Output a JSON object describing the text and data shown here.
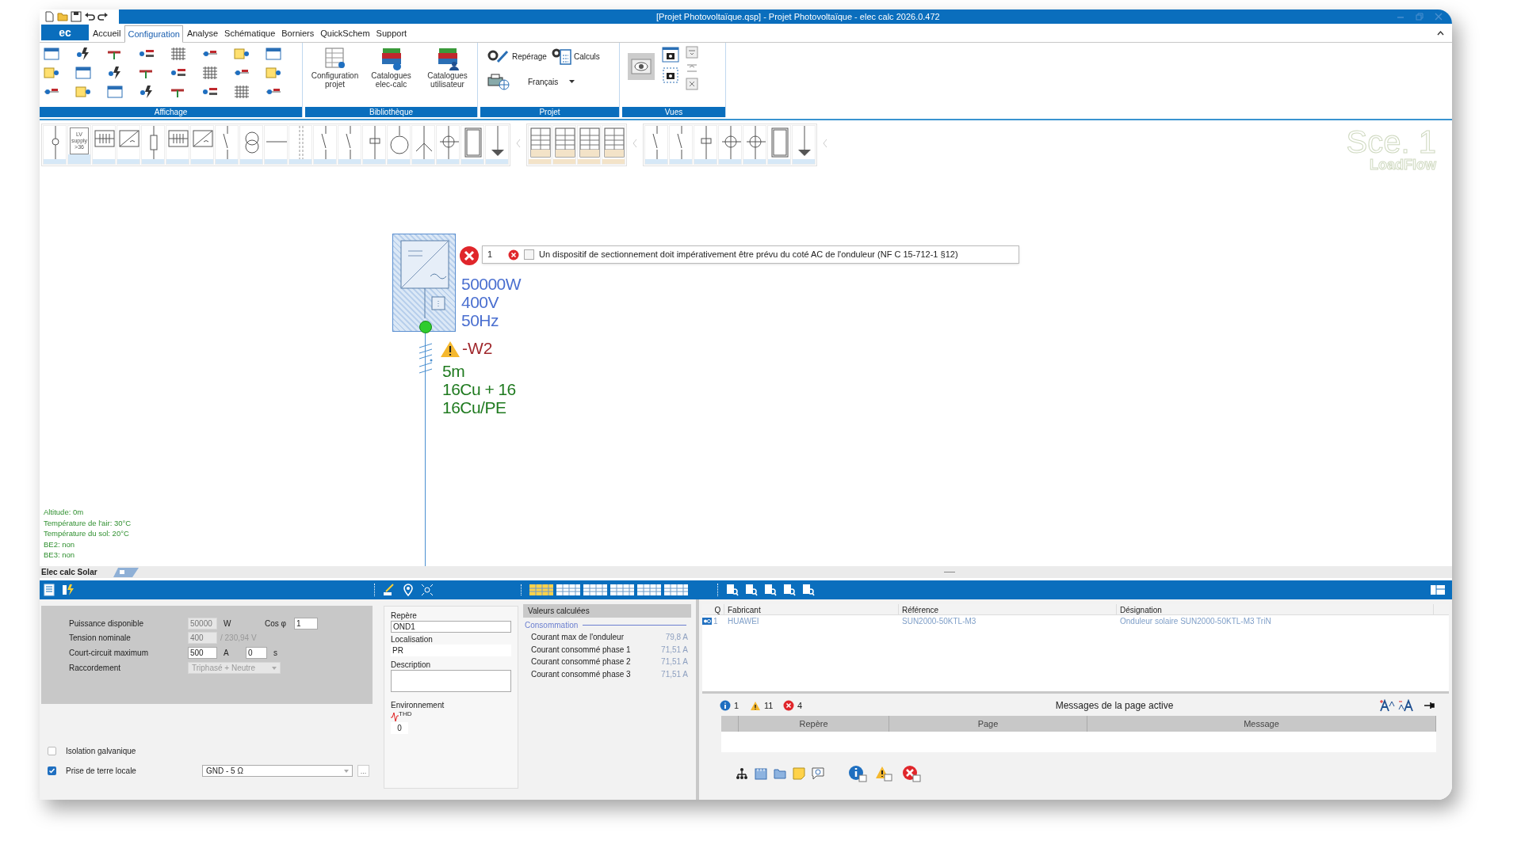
{
  "window": {
    "title": "[Projet Photovoltaïque.qsp] - Projet Photovoltaïque - elec calc 2026.0.472"
  },
  "app_button": "ec",
  "menu_tabs": [
    {
      "label": "Accueil",
      "selected": false
    },
    {
      "label": "Configuration",
      "selected": true
    },
    {
      "label": "Analyse",
      "selected": false
    },
    {
      "label": "Schématique",
      "selected": false
    },
    {
      "label": "Borniers",
      "selected": false
    },
    {
      "label": "QuickSchem",
      "selected": false
    },
    {
      "label": "Support",
      "selected": false
    }
  ],
  "ribbon": {
    "affichage": {
      "label": "Affichage"
    },
    "bibliotheque": {
      "label": "Bibliothèque",
      "buttons": [
        {
          "kind": "config",
          "label": "Configuration projet"
        },
        {
          "kind": "books",
          "label": "Catalogues elec-calc"
        },
        {
          "kind": "books_user",
          "label": "Catalogues utilisateur"
        }
      ]
    },
    "projet": {
      "label": "Projet",
      "repere": "Repérage",
      "calculs": "Calculs",
      "language": "Français"
    },
    "vues": {
      "label": "Vues"
    }
  },
  "symbol_toolbar": {
    "supply_label": "LV supply >36"
  },
  "scenario": {
    "name": "Sce. 1",
    "mode": "LoadFlow"
  },
  "diagram": {
    "connected": true,
    "error": {
      "count": "1",
      "message": "Un dispositif de sectionnement doit impérativement être prévu du coté AC de l'onduleur (NF C 15-712-1 §12)"
    },
    "ratings": [
      "50000W",
      "400V",
      "50Hz"
    ],
    "cable": {
      "name": "-W2",
      "warning": true,
      "lines": [
        "5m",
        "16Cu + 16",
        "16Cu/PE"
      ]
    }
  },
  "environment": [
    "Altitude: 0m",
    "Température de l'air: 30°C",
    "Température du sol: 20°C",
    "BE2: non",
    "BE3: non"
  ],
  "bottom_tab": "Elec calc Solar",
  "source": {
    "power": {
      "label": "Puissance disponible",
      "value": "50000",
      "unit": "W",
      "disabled": true
    },
    "cos_phi": {
      "label": "Cos φ",
      "value": "1",
      "disabled": false
    },
    "voltage": {
      "label": "Tension nominale",
      "value": "400",
      "note": "/ 230,94 V",
      "disabled": true
    },
    "short_circuit": {
      "label": "Court-circuit maximum",
      "value": "500",
      "unit": "A",
      "time_value": "0",
      "time_unit": "s",
      "disabled": false
    },
    "connection": {
      "label": "Raccordement",
      "value": "Triphasé + Neutre",
      "disabled": true
    },
    "options": [
      {
        "label": "Isolation galvanique",
        "checked": false
      },
      {
        "label": "Prise de terre locale",
        "checked": true,
        "select": "GND - 5 Ω",
        "browse": "..."
      }
    ]
  },
  "identity": {
    "repere_label": "Repère",
    "repere": "OND1",
    "localisation_label": "Localisation",
    "localisation": "PR",
    "description_label": "Description",
    "environment_label": "Environnement",
    "thd_label": "THD",
    "thd_value": "0"
  },
  "computed": {
    "title": "Valeurs calculées",
    "section": "Consommation",
    "rows": [
      {
        "label": "Courant max de l'onduleur",
        "value": "79,8 A"
      },
      {
        "label": "Courant consommé phase 1",
        "value": "71,51 A"
      },
      {
        "label": "Courant consommé phase 2",
        "value": "71,51 A"
      },
      {
        "label": "Courant consommé phase 3",
        "value": "71,51 A"
      }
    ]
  },
  "components": {
    "columns": [
      "Q",
      "Fabricant",
      "Référence",
      "Désignation"
    ],
    "rows": [
      {
        "q": "1",
        "fabricant": "HUAWEI",
        "reference": "SUN2000-50KTL-M3",
        "designation": "Onduleur solaire SUN2000-50KTL-M3 TriN"
      }
    ]
  },
  "messages": {
    "info_count": "1",
    "warning_count": "11",
    "error_count": "4",
    "title": "Messages de la page active",
    "columns": [
      "Repère",
      "Page",
      "Message"
    ]
  }
}
